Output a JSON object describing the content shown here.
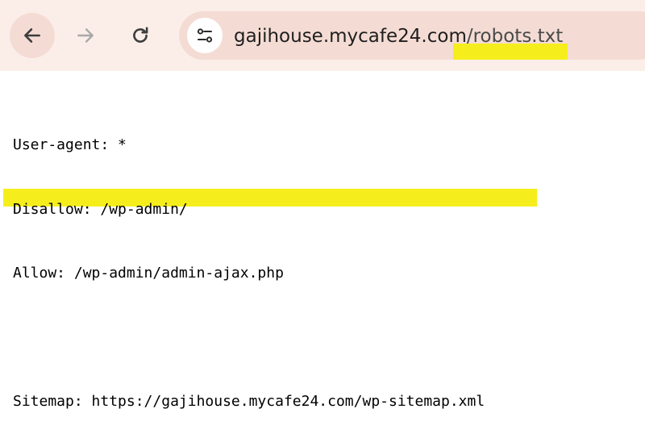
{
  "browser": {
    "back_icon": "arrow-left-icon",
    "forward_icon": "arrow-right-icon",
    "reload_icon": "reload-icon",
    "site_info_icon": "tune-icon",
    "url_host": "gajihouse.mycafe24.com",
    "url_path": "/robots.txt",
    "toolbar_bg": "#fbeee9",
    "highlight_color": "#f6ee1c"
  },
  "robots": {
    "line1": "User-agent: *",
    "line2": "Disallow: /wp-admin/",
    "line3": "Allow: /wp-admin/admin-ajax.php",
    "line4": "",
    "line5": "Sitemap: https://gajihouse.mycafe24.com/wp-sitemap.xml"
  }
}
